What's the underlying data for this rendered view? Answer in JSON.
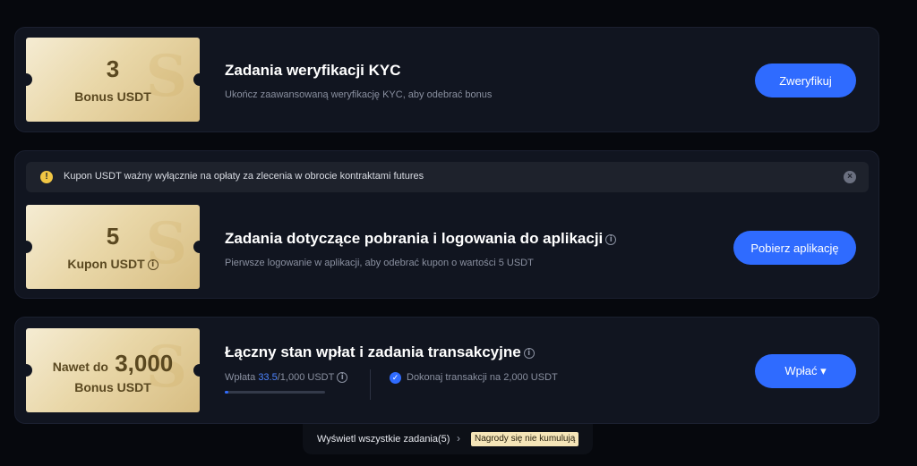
{
  "tasks": [
    {
      "ticket_amount": "3",
      "ticket_label": "Bonus USDT",
      "title": "Zadania weryfikacji KYC",
      "description": "Ukończ zaawansowaną weryfikację KYC, aby odebrać bonus",
      "button_label": "Zweryfikuj"
    },
    {
      "notice_text": "Kupon USDT ważny wyłącznie na opłaty za zlecenia w obrocie kontraktami futures",
      "ticket_amount": "5",
      "ticket_label": "Kupon USDT",
      "title": "Zadania dotyczące pobrania i logowania do aplikacji",
      "description": "Pierwsze logowanie w aplikacji, aby odebrać kupon o wartości 5 USDT",
      "button_label": "Pobierz aplikację"
    },
    {
      "ticket_prefix": "Nawet do",
      "ticket_amount": "3,000",
      "ticket_label": "Bonus USDT",
      "title": "Łączny stan wpłat i zadania transakcyjne",
      "deposit_label": "Wpłata",
      "deposit_current": "33.5",
      "deposit_target": "/1,000 USDT",
      "deposit_progress": 0.0335,
      "trade_text": "Dokonaj transakcji na 2,000 USDT",
      "button_label": "Wpłać ▾"
    }
  ],
  "footer": {
    "view_all": "Wyświetl wszystkie zadania(5)",
    "badge": "Nagrody się nie kumulują"
  },
  "colors": {
    "accent": "#2f6bff",
    "card_bg": "#111520",
    "gold": "#e9d7a8"
  }
}
